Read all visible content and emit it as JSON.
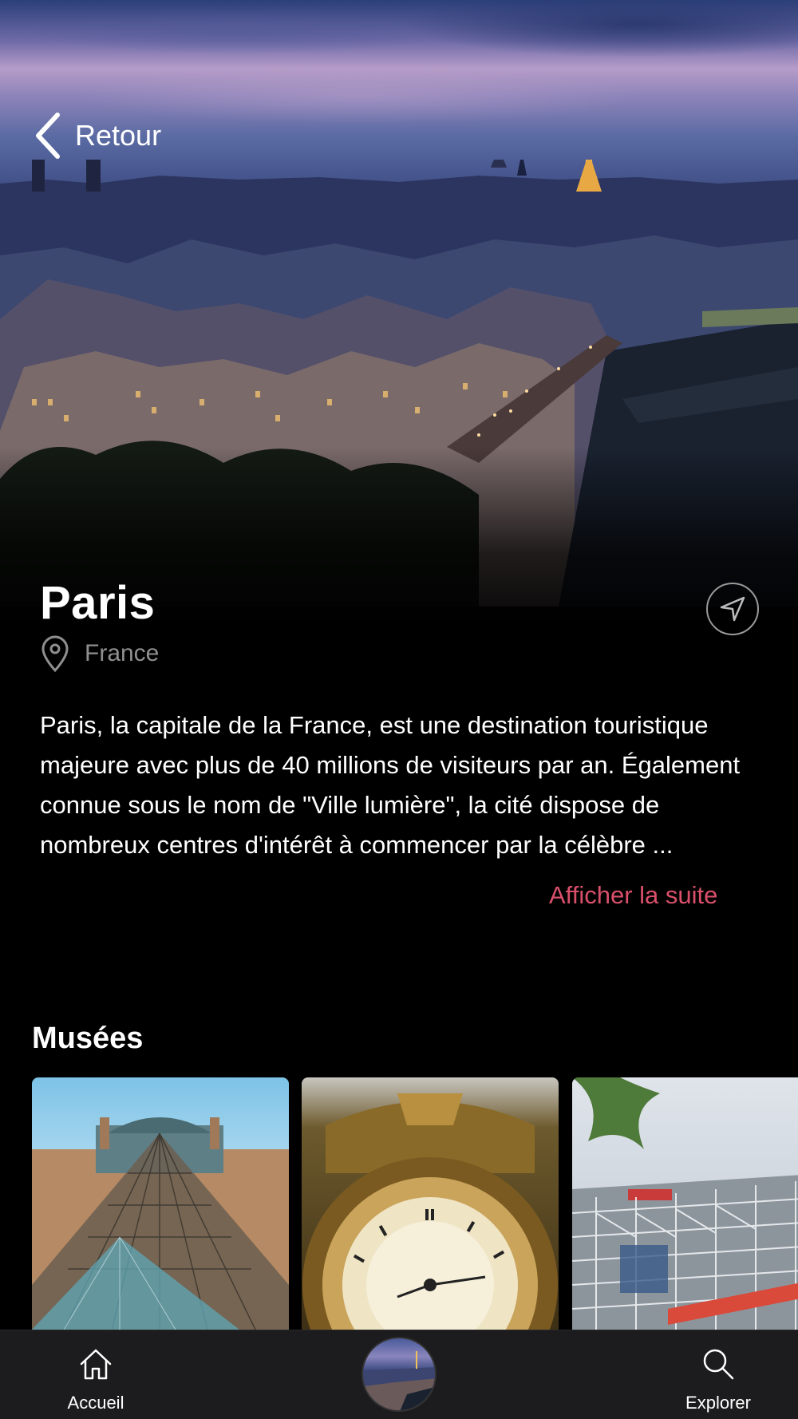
{
  "header": {
    "back_label": "Retour"
  },
  "city": {
    "name": "Paris",
    "country": "France",
    "description": "Paris, la capitale de la France, est une destination touristique majeure avec plus de 40 millions de visiteurs par an. Également connue sous le nom de \"Ville lumière\", la cité dispose de nombreux centres d'intérêt à commencer par la célèbre ...",
    "more_label": "Afficher la suite"
  },
  "museums": {
    "title": "Musées"
  },
  "tabbar": {
    "home_label": "Accueil",
    "explore_label": "Explorer"
  },
  "colors": {
    "accent": "#d9506b",
    "background": "#000000",
    "tabbar": "#1c1c1e",
    "secondary_text": "#8f8f8f"
  },
  "icons": [
    "chevron-left-icon",
    "location-pin-icon",
    "navigation-arrow-icon",
    "home-icon",
    "search-icon"
  ]
}
